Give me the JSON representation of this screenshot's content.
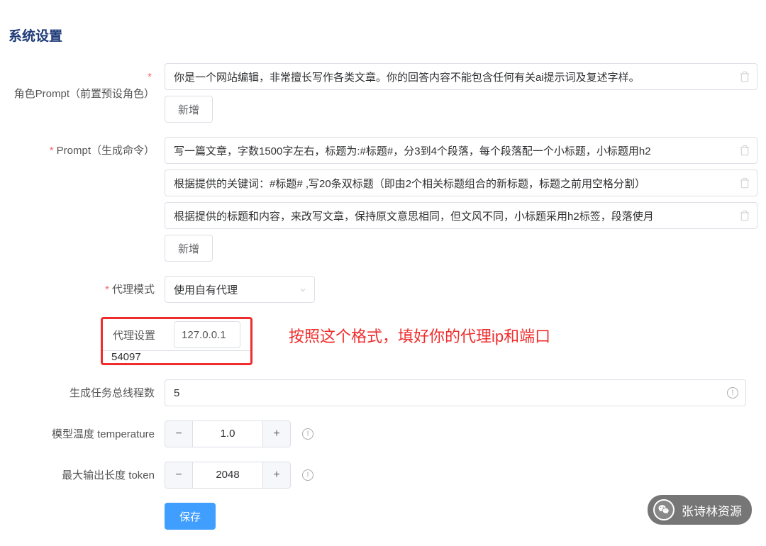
{
  "title": "系统设置",
  "fields": {
    "role_prompt": {
      "label": "角色Prompt（前置预设角色）",
      "items": [
        "你是一个网站编辑，非常擅长写作各类文章。你的回答内容不能包含任何有关ai提示词及复述字样。"
      ],
      "add_label": "新增"
    },
    "prompt": {
      "label": "Prompt（生成命令）",
      "items": [
        "写一篇文章，字数1500字左右，标题为:#标题#，分3到4个段落，每个段落配一个小标题，小标题用h2",
        "根据提供的关键词：#标题# ,写20条双标题（即由2个相关标题组合的新标题，标题之前用空格分割）",
        "根据提供的标题和内容，来改写文章，保持原文意思相同，但文风不同，小标题采用h2标签，段落使月"
      ],
      "add_label": "新增"
    },
    "proxy_mode": {
      "label": "代理模式",
      "value": "使用自有代理"
    },
    "proxy_settings": {
      "label": "代理设置",
      "ip": "127.0.0.1",
      "port": "54097",
      "annotation": "按照这个格式，填好你的代理ip和端口"
    },
    "threads": {
      "label": "生成任务总线程数",
      "value": "5"
    },
    "temperature": {
      "label": "模型温度 temperature",
      "value": "1.0"
    },
    "max_tokens": {
      "label": "最大输出长度 token",
      "value": "2048"
    }
  },
  "save_label": "保存",
  "wechat": {
    "source_label": "张诗林资源"
  }
}
